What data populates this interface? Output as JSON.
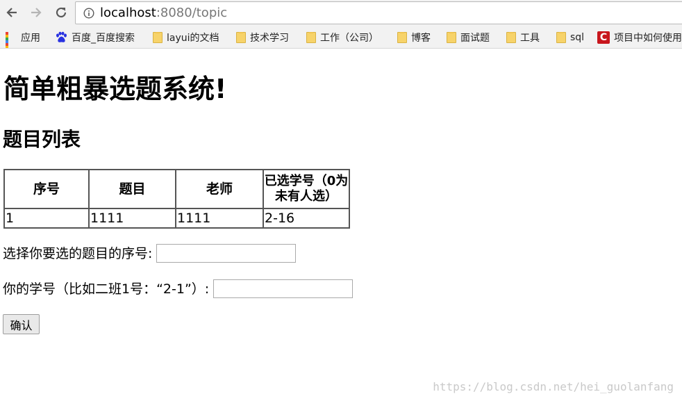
{
  "browser": {
    "url_host": "localhost",
    "url_rest": ":8080/topic",
    "icons": {
      "back": "back-arrow-icon",
      "forward": "forward-arrow-icon",
      "reload": "reload-icon",
      "info": "info-icon"
    }
  },
  "bookmarks": {
    "items": [
      {
        "label": "应用",
        "icon": "apps-grid-icon"
      },
      {
        "label": "百度_百度搜索",
        "icon": "baidu-paw-icon"
      },
      {
        "label": "layui的文档",
        "icon": "folder-icon"
      },
      {
        "label": "技术学习",
        "icon": "folder-icon"
      },
      {
        "label": "工作（公司）",
        "icon": "folder-icon"
      },
      {
        "label": "博客",
        "icon": "folder-icon"
      },
      {
        "label": "面试题",
        "icon": "folder-icon"
      },
      {
        "label": "工具",
        "icon": "folder-icon"
      },
      {
        "label": "sql",
        "icon": "folder-icon"
      },
      {
        "label": "项目中如何使用",
        "icon": "red-c-icon"
      }
    ]
  },
  "page": {
    "title": "简单粗暴选题系统!",
    "section_title": "题目列表"
  },
  "table": {
    "headers": [
      "序号",
      "题目",
      "老师",
      "已选学号（0为未有人选）"
    ],
    "rows": [
      [
        "1",
        "1111",
        "1111",
        "2-16"
      ]
    ]
  },
  "form": {
    "topic_label": "选择你要选的题目的序号:",
    "topic_value": "",
    "student_label": "你的学号（比如二班1号：“2-1”）:",
    "student_value": "",
    "confirm_label": "确认"
  },
  "watermark": "https://blog.csdn.net/hei_guolanfang",
  "colors": {
    "toolbar_bg": "#f2f2f2",
    "folder": "#f7d36a",
    "baidu_blue": "#2932e1",
    "csdn_red": "#c8161d",
    "table_border": "#555555"
  }
}
